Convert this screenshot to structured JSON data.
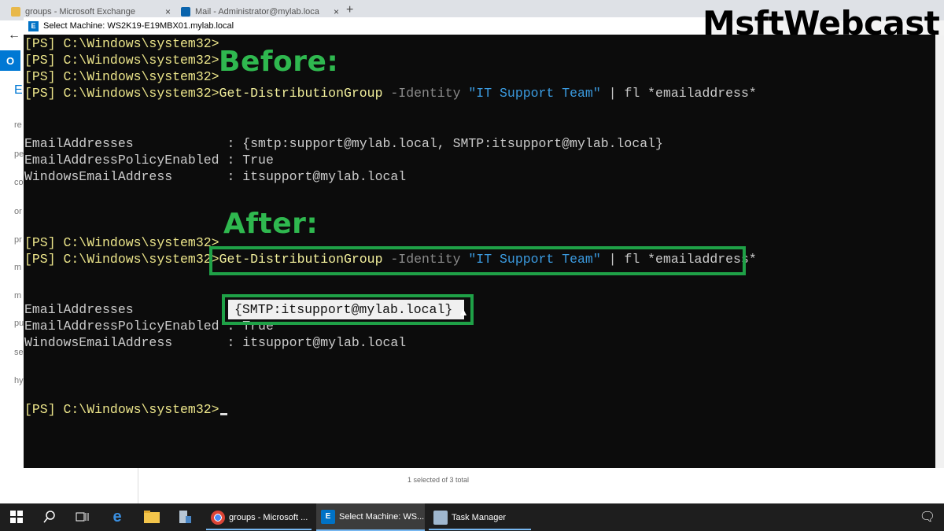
{
  "browser": {
    "tabs": [
      {
        "title": "groups - Microsoft Exchange"
      },
      {
        "title": "Mail - Administrator@mylab.loca"
      }
    ],
    "close_glyph": "×",
    "new_tab_glyph": "+",
    "back_glyph": "←",
    "sidebar_letters": [
      "E",
      "re",
      "pe",
      "co",
      "or",
      "pr",
      "m",
      "m",
      "pu",
      "se",
      "hy"
    ],
    "status_text": "1 selected of 3 total"
  },
  "console": {
    "title": "Select Machine: WS2K19-E19MBX01.mylab.local",
    "lines": [
      {
        "prompt": "[PS] C:\\Windows\\system32>"
      },
      {
        "prompt": "[PS] C:\\Windows\\system32>"
      },
      {
        "prompt": "[PS] C:\\Windows\\system32>"
      },
      {
        "prompt": "[PS] C:\\Windows\\system32>",
        "cmd": "Get-DistributionGroup",
        "param": " -Identity ",
        "str": "\"IT Support Team\"",
        "rest": " | fl *emailaddress*"
      },
      {
        "text": "EmailAddresses            : {smtp:support@mylab.local, SMTP:itsupport@mylab.local}"
      },
      {
        "text": "EmailAddressPolicyEnabled : True"
      },
      {
        "text": "WindowsEmailAddress       : itsupport@mylab.local"
      },
      {
        "prompt": "[PS] C:\\Windows\\system32>"
      },
      {
        "prompt": "[PS] C:\\Windows\\system32>",
        "cmd": "Get-DistributionGroup",
        "param": " -Identity ",
        "str": "\"IT Support Team\"",
        "rest": " | fl *emailaddress*"
      },
      {
        "text": "EmailAddresses            : "
      },
      {
        "text": "EmailAddressPolicyEnabled : True"
      },
      {
        "text": "WindowsEmailAddress       : itsupport@mylab.local"
      },
      {
        "prompt": "[PS] C:\\Windows\\system32>"
      }
    ],
    "highlighted_value": "{SMTP:itsupport@mylab.local}"
  },
  "annotations": {
    "before": "Before:",
    "after": "After:",
    "watermark": "MsftWebcast",
    "accent_color": "#2fb84f"
  },
  "taskbar": {
    "items": [
      {
        "label": "groups - Microsoft ...",
        "icon": "chrome-icon"
      },
      {
        "label": "Select Machine: WS...",
        "icon": "exchange-shell-icon"
      },
      {
        "label": "Task Manager",
        "icon": "task-manager-icon"
      }
    ]
  }
}
